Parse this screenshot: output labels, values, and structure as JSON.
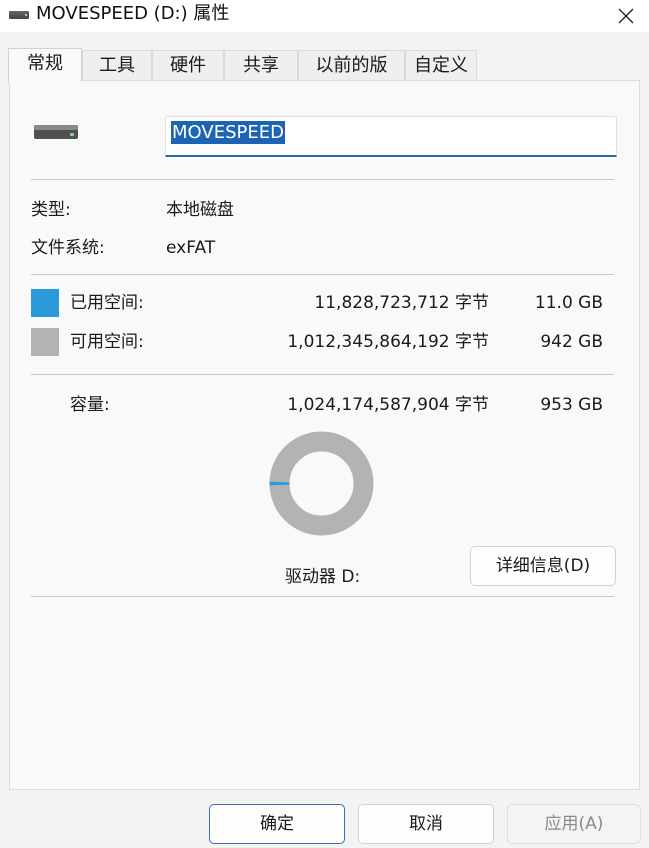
{
  "window": {
    "title": "MOVESPEED (D:) 属性",
    "close_glyph": "✕"
  },
  "tabs": [
    {
      "label": "常规",
      "active": true
    },
    {
      "label": "工具",
      "active": false
    },
    {
      "label": "硬件",
      "active": false
    },
    {
      "label": "共享",
      "active": false
    },
    {
      "label": "以前的版本",
      "active": false
    },
    {
      "label": "自定义",
      "active": false
    }
  ],
  "general": {
    "drive_icon": "drive-icon",
    "volume_name": "MOVESPEED",
    "type_label": "类型:",
    "type_value": "本地磁盘",
    "fs_label": "文件系统:",
    "fs_value": "exFAT",
    "used": {
      "label": "已用空间:",
      "bytes": "11,828,723,712 字节",
      "size": "11.0 GB",
      "color": "#2a9ad8"
    },
    "free": {
      "label": "可用空间:",
      "bytes": "1,012,345,864,192 字节",
      "size": "942 GB",
      "color": "#b3b3b3"
    },
    "capacity": {
      "label": "容量:",
      "bytes": "1,024,174,587,904 字节",
      "size": "953 GB"
    },
    "used_fraction": 0.0115,
    "drive_label": "驱动器 D:",
    "details_button": "详细信息(D)"
  },
  "buttons": {
    "ok": "确定",
    "cancel": "取消",
    "apply": "应用(A)"
  }
}
